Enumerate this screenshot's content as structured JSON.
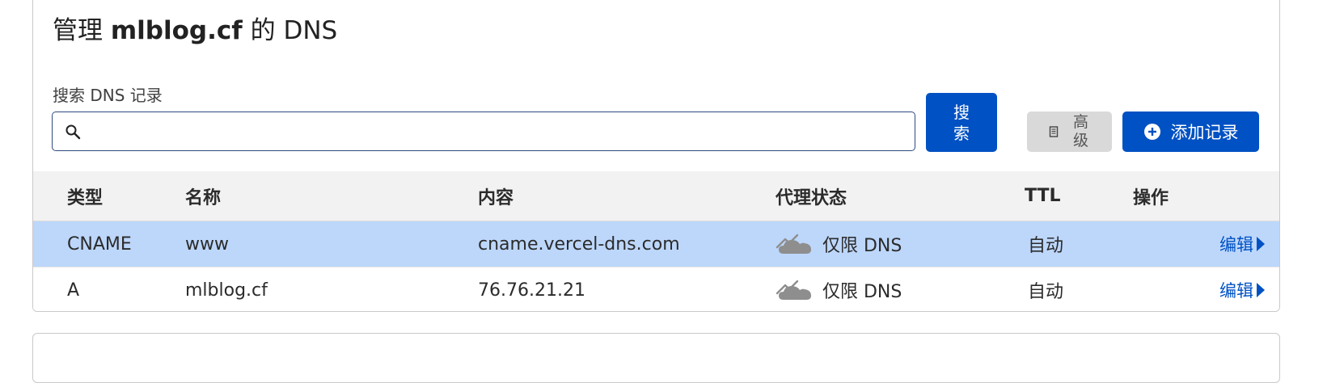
{
  "header": {
    "title_prefix": "管理",
    "title_domain": "mlblog.cf",
    "title_suffix": "的 DNS"
  },
  "search": {
    "label": "搜索 DNS 记录",
    "value": "",
    "placeholder": "",
    "button_label": "搜索"
  },
  "toolbar": {
    "advanced_label": "高级",
    "add_record_label": "添加记录"
  },
  "table": {
    "columns": [
      "类型",
      "名称",
      "内容",
      "代理状态",
      "TTL",
      "操作"
    ],
    "rows": [
      {
        "type": "CNAME",
        "name": "www",
        "content": "cname.vercel-dns.com",
        "proxy_status": "仅限 DNS",
        "ttl": "自动",
        "action": "编辑",
        "selected": true
      },
      {
        "type": "A",
        "name": "mlblog.cf",
        "content": "76.76.21.21",
        "proxy_status": "仅限 DNS",
        "ttl": "自动",
        "action": "编辑",
        "selected": false
      }
    ]
  },
  "colors": {
    "primary": "#0051c3",
    "selected_row": "#bdd7fb",
    "header_bg": "#f2f2f2",
    "cloud_gray": "#8e8e8e"
  },
  "icons": {
    "search": "search-icon",
    "advanced": "document-icon",
    "add": "plus-circle-icon",
    "proxy": "dns-only-cloud-icon",
    "edit": "caret-right-icon"
  }
}
